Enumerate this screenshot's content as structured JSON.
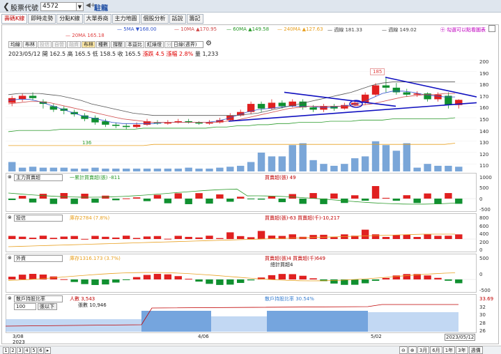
{
  "topbar": {
    "title": "股票代號",
    "code": "4572",
    "dropdown": "▼",
    "mini": "◀+",
    "company": "駐龍"
  },
  "tabs": [
    "壽碼K線",
    "即時走勢",
    "分點K線",
    "大單券商",
    "主力地圖",
    "個股分析",
    "話說",
    "籌記"
  ],
  "active_tab": 0,
  "hint": "㊉ 勾選可以點看圖表",
  "ma": [
    {
      "label": "5MA ▼168.00",
      "color": "#3355cc"
    },
    {
      "label": "10MA ▲170.95",
      "color": "#d04848"
    },
    {
      "label": "60MA ▲149.58",
      "color": "#2a9a2a"
    },
    {
      "label": "240MA ▲127.63",
      "color": "#e8a020"
    },
    {
      "label": "週線 181.33",
      "color": "#444"
    },
    {
      "label": "週線 149.02",
      "color": "#444"
    }
  ],
  "ma20": "20MA 165.18",
  "subtabs": [
    "均線",
    "布林",
    "投信",
    "自營",
    "融資",
    "布林",
    "種數",
    "撐壓",
    "本益比",
    "紅綠燈",
    "分價量"
  ],
  "subtab_on": 5,
  "period_select": "日線(週界)",
  "ohlc": {
    "date": "2023/05/12",
    "open_label": "開",
    "open": "162.5",
    "high_label": "高",
    "high": "165.5",
    "low_label": "低",
    "low": "158.5",
    "close_label": "收",
    "close": "165.5",
    "chg_label": "漲跌",
    "chg": "4.5",
    "pct_label": "漲幅",
    "pct": "2.8%",
    "vol_label": "量",
    "vol": "1,233"
  },
  "price_axis": [
    "200",
    "190",
    "180",
    "170",
    "160",
    "150",
    "140",
    "130",
    "120",
    "110"
  ],
  "annot_high": "185",
  "annot_low": "136",
  "panels": [
    {
      "select": "主力買賣超",
      "legend1": "一累計買賣超(張) -811",
      "legend1_color": "#2a9a2a",
      "legend2": "買賣超(張) 49",
      "legend2_color": "#c00000",
      "axis": [
        "1000",
        "500",
        "0",
        "-500"
      ]
    },
    {
      "select": "投信",
      "legend1": "庫存2784 (7.8%)",
      "legend1_color": "#e8a020",
      "legend2": "買賣超(張)-63 買賣超(千)-10,217",
      "legend2_color": "#c00000",
      "axis": [
        "800",
        "600",
        "400",
        "200",
        "0"
      ]
    },
    {
      "select": "外資",
      "legend1": "庫存1316.173 (3.7%)",
      "legend1_color": "#e8a020",
      "legend2": "買賣超(張)4 買賣超(千)649",
      "legend2_color": "#c00000",
      "extra": "總計買超4",
      "axis": [
        "500",
        "0",
        "-500"
      ]
    },
    {
      "select": "散戶持股比率",
      "legend1": "人數 3,543",
      "legend1_color": "#c00000",
      "legend1b": "張數 10,946",
      "legend2": "散戶持股比率 30.54%",
      "legend2_color": "#3a7fd0",
      "axis": [
        "33.69",
        "32",
        "30",
        "28",
        "26"
      ],
      "filter_value": "100",
      "filter_label": "張以下"
    }
  ],
  "dates": [
    "3/08",
    "2023",
    "4/06",
    "5/02",
    "2023/05/12"
  ],
  "footer": {
    "pages": [
      "1",
      "2",
      "3",
      "4",
      "5",
      "6"
    ],
    "ranges": [
      "3月",
      "6月",
      "1年",
      "3年",
      "週價"
    ],
    "arrow": "▸"
  }
}
